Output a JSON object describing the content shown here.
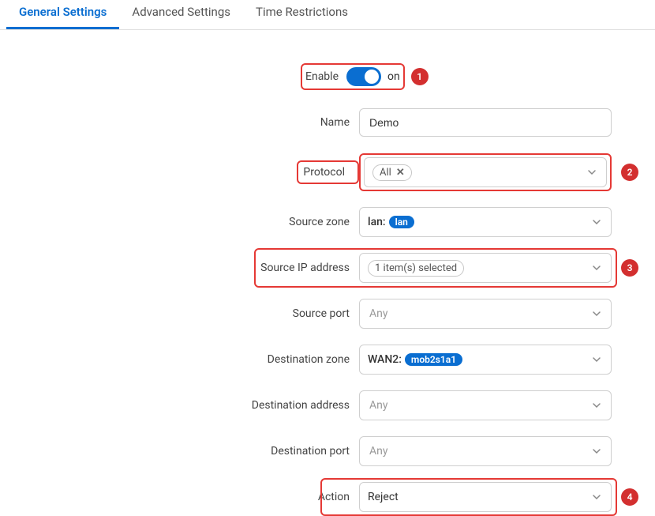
{
  "tabs": {
    "general": "General Settings",
    "advanced": "Advanced Settings",
    "time": "Time Restrictions"
  },
  "form": {
    "enable": {
      "label": "Enable",
      "state": "on"
    },
    "name": {
      "label": "Name",
      "value": "Demo"
    },
    "protocol": {
      "label": "Protocol",
      "chip": "All"
    },
    "source_zone": {
      "label": "Source zone",
      "prefix": "lan:",
      "pill": "lan"
    },
    "source_ip": {
      "label": "Source IP address",
      "chip": "1 item(s) selected"
    },
    "source_port": {
      "label": "Source port",
      "placeholder": "Any"
    },
    "dest_zone": {
      "label": "Destination zone",
      "prefix": "WAN2:",
      "pill": "mob2s1a1"
    },
    "dest_addr": {
      "label": "Destination address",
      "placeholder": "Any"
    },
    "dest_port": {
      "label": "Destination port",
      "placeholder": "Any"
    },
    "action": {
      "label": "Action",
      "value": "Reject"
    }
  },
  "annotations": {
    "b1": "1",
    "b2": "2",
    "b3": "3",
    "b4": "4"
  }
}
